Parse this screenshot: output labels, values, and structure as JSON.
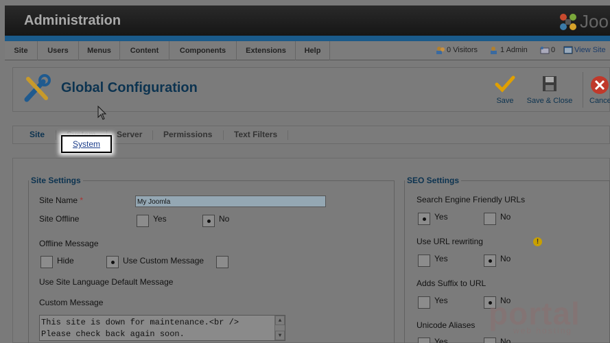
{
  "header": {
    "title": "Administration",
    "logo_text": "Joo"
  },
  "menu": {
    "items": [
      "Site",
      "Users",
      "Menus",
      "Content",
      "Components",
      "Extensions",
      "Help"
    ]
  },
  "status": {
    "visitors": "0 Visitors",
    "admin": "1 Admin",
    "messages": "0",
    "view_site": "View Site"
  },
  "toolbar": {
    "page_title": "Global Configuration",
    "save": "Save",
    "save_close": "Save & Close",
    "cancel": "Cancel"
  },
  "tabs": {
    "site": "Site",
    "system": "System",
    "server": "Server",
    "permissions": "Permissions",
    "text_filters": "Text Filters"
  },
  "callout": {
    "label": "System"
  },
  "site_settings": {
    "legend": "Site Settings",
    "site_name_label": "Site Name",
    "required_marker": "*",
    "site_name_value": "My Joomla",
    "site_offline_label": "Site Offline",
    "yes": "Yes",
    "no": "No",
    "offline_message_label": "Offline Message",
    "hide": "Hide",
    "use_custom": "Use Custom Message",
    "use_default": "Use Site Language Default Message",
    "custom_message_label": "Custom Message",
    "custom_message_line1": "This site is down for maintenance.<br />",
    "custom_message_line2": "Please check back again soon."
  },
  "seo_settings": {
    "legend": "SEO Settings",
    "sef_label": "Search Engine Friendly URLs",
    "rewrite_label": "Use URL rewriting",
    "suffix_label": "Adds Suffix to URL",
    "unicode_label": "Unicode Aliases",
    "yes": "Yes",
    "no": "No"
  },
  "colors": {
    "accent": "#0c3350",
    "header_bg": "#1e1e1e",
    "blue_bar": "#1a5a8a",
    "save_check": "#e0a000",
    "cancel_red": "#c0392b"
  },
  "watermark": {
    "brand": "portal",
    "tagline": "web hosting"
  }
}
